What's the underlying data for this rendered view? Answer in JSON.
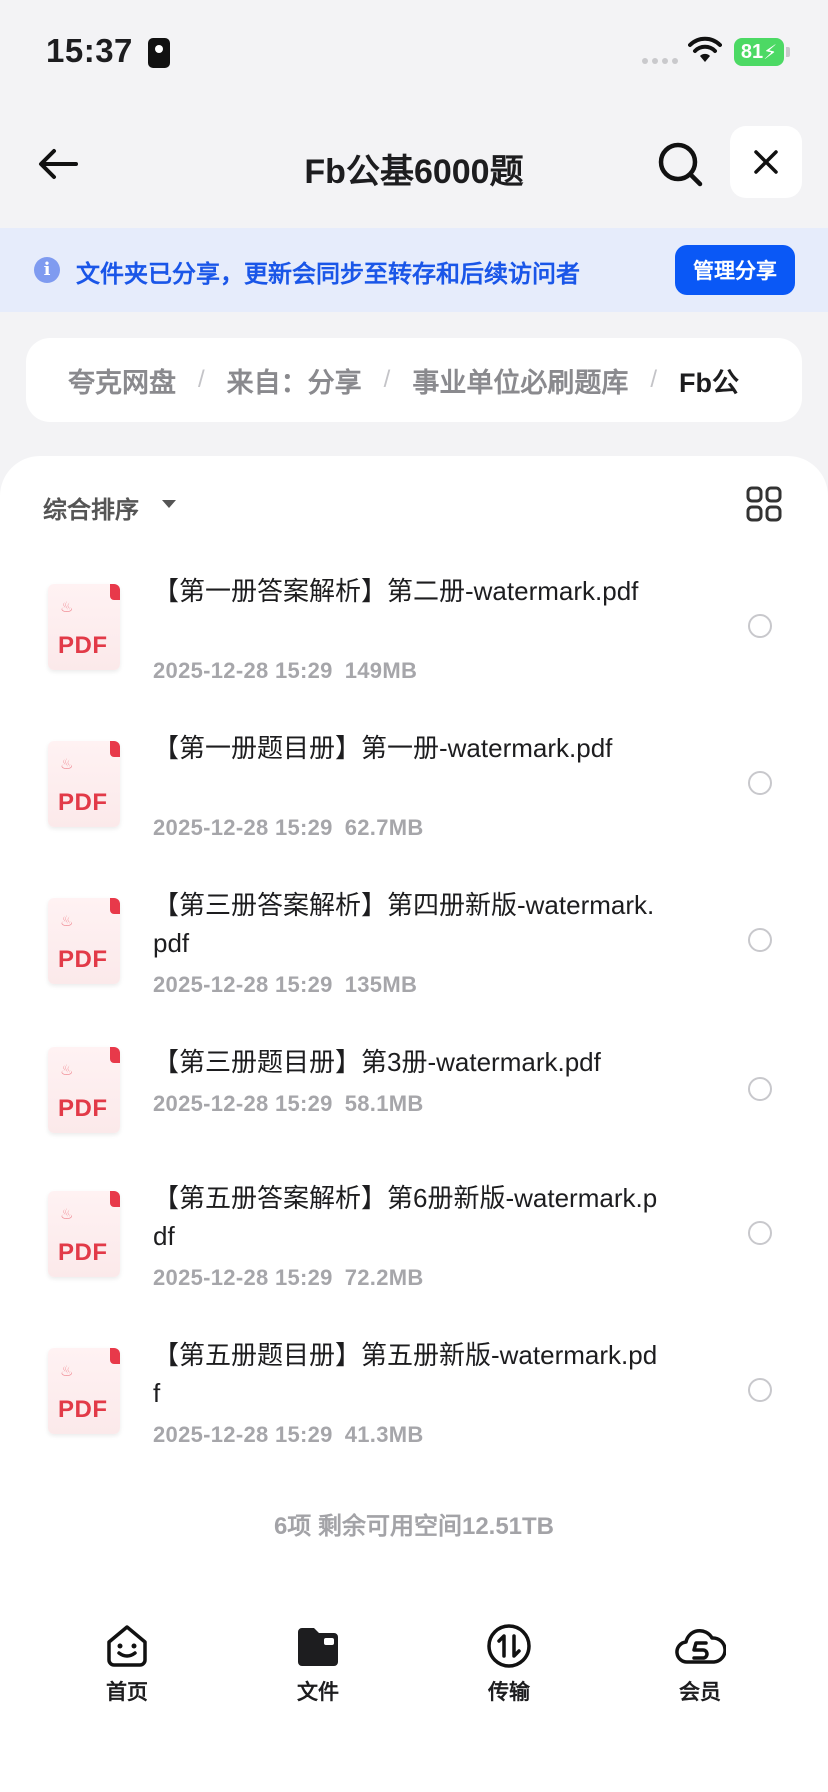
{
  "status_bar": {
    "time": "15:37",
    "battery": "81"
  },
  "nav": {
    "title": "Fb公基6000题",
    "back_icon": "back-arrow-icon",
    "search_icon": "search-icon",
    "close_icon": "close-icon"
  },
  "banner": {
    "text": "文件夹已分享，更新会同步至转存和后续访问者",
    "button": "管理分享",
    "accent": "#0a58f6"
  },
  "breadcrumb": {
    "items": [
      "夸克网盘",
      "来自：分享",
      "事业单位必刷题库",
      "Fb公"
    ]
  },
  "list": {
    "sort_label": "综合排序",
    "files": [
      {
        "name": "【第一册答案解析】第二册-watermark.pdf",
        "date": "2025-12-28 15:29",
        "size": "149MB",
        "type": "PDF"
      },
      {
        "name": "【第一册题目册】第一册-watermark.pdf",
        "date": "2025-12-28 15:29",
        "size": "62.7MB",
        "type": "PDF"
      },
      {
        "name": "【第三册答案解析】第四册新版-watermark.pdf",
        "date": "2025-12-28 15:29",
        "size": "135MB",
        "type": "PDF"
      },
      {
        "name": "【第三册题目册】第3册-watermark.pdf",
        "date": "2025-12-28 15:29",
        "size": "58.1MB",
        "type": "PDF"
      },
      {
        "name": "【第五册答案解析】第6册新版-watermark.pdf",
        "date": "2025-12-28 15:29",
        "size": "72.2MB",
        "type": "PDF"
      },
      {
        "name": "【第五册题目册】第五册新版-watermark.pdf",
        "date": "2025-12-28 15:29",
        "size": "41.3MB",
        "type": "PDF"
      }
    ],
    "footer": "6项 剩余可用空间12.51TB"
  },
  "tabbar": {
    "tabs": [
      {
        "label": "首页",
        "icon": "home-face-icon"
      },
      {
        "label": "文件",
        "icon": "folder-icon"
      },
      {
        "label": "传输",
        "icon": "transfer-icon"
      },
      {
        "label": "会员",
        "icon": "cloud-member-icon"
      }
    ]
  }
}
